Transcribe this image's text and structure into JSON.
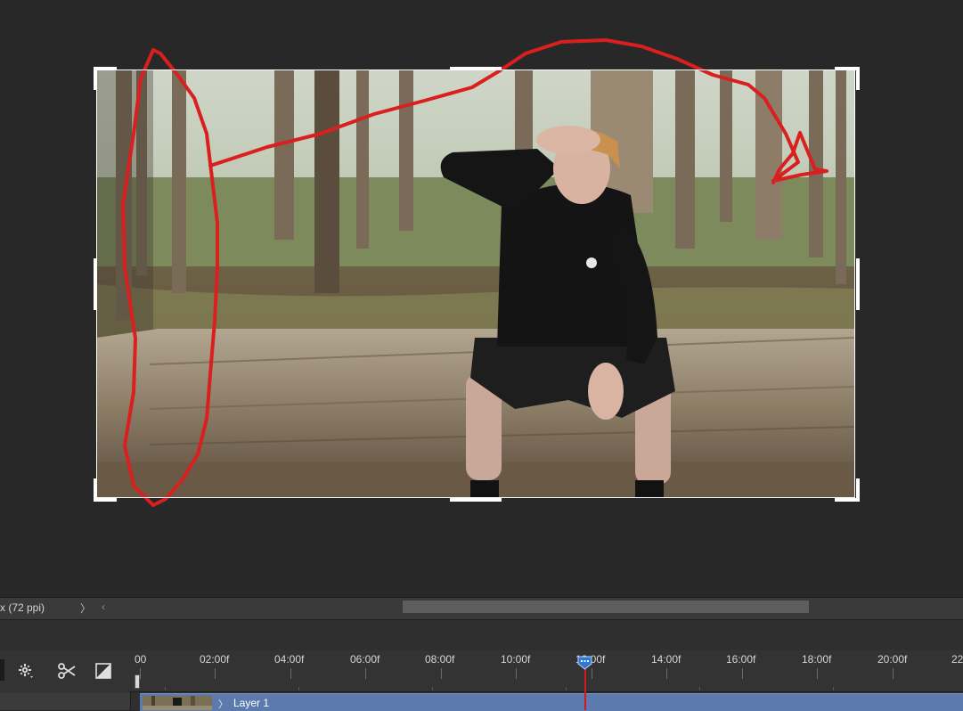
{
  "status_bar": {
    "doc_info": "x (72 ppi)",
    "chevron": "〉",
    "scroll_left": "‹"
  },
  "timeline": {
    "ruler_labels": [
      "00",
      "02:00f",
      "04:00f",
      "06:00f",
      "08:00f",
      "10:00f",
      "12:00f",
      "14:00f",
      "16:00f",
      "18:00f",
      "20:00f",
      "22"
    ],
    "layer_name": "Layer 1",
    "layer_chevron": "〉"
  },
  "annotation": {
    "stroke_color": "#d9201f"
  },
  "icons": {
    "settings": "gear-icon",
    "split": "scissors-icon",
    "transition": "transition-icon"
  }
}
